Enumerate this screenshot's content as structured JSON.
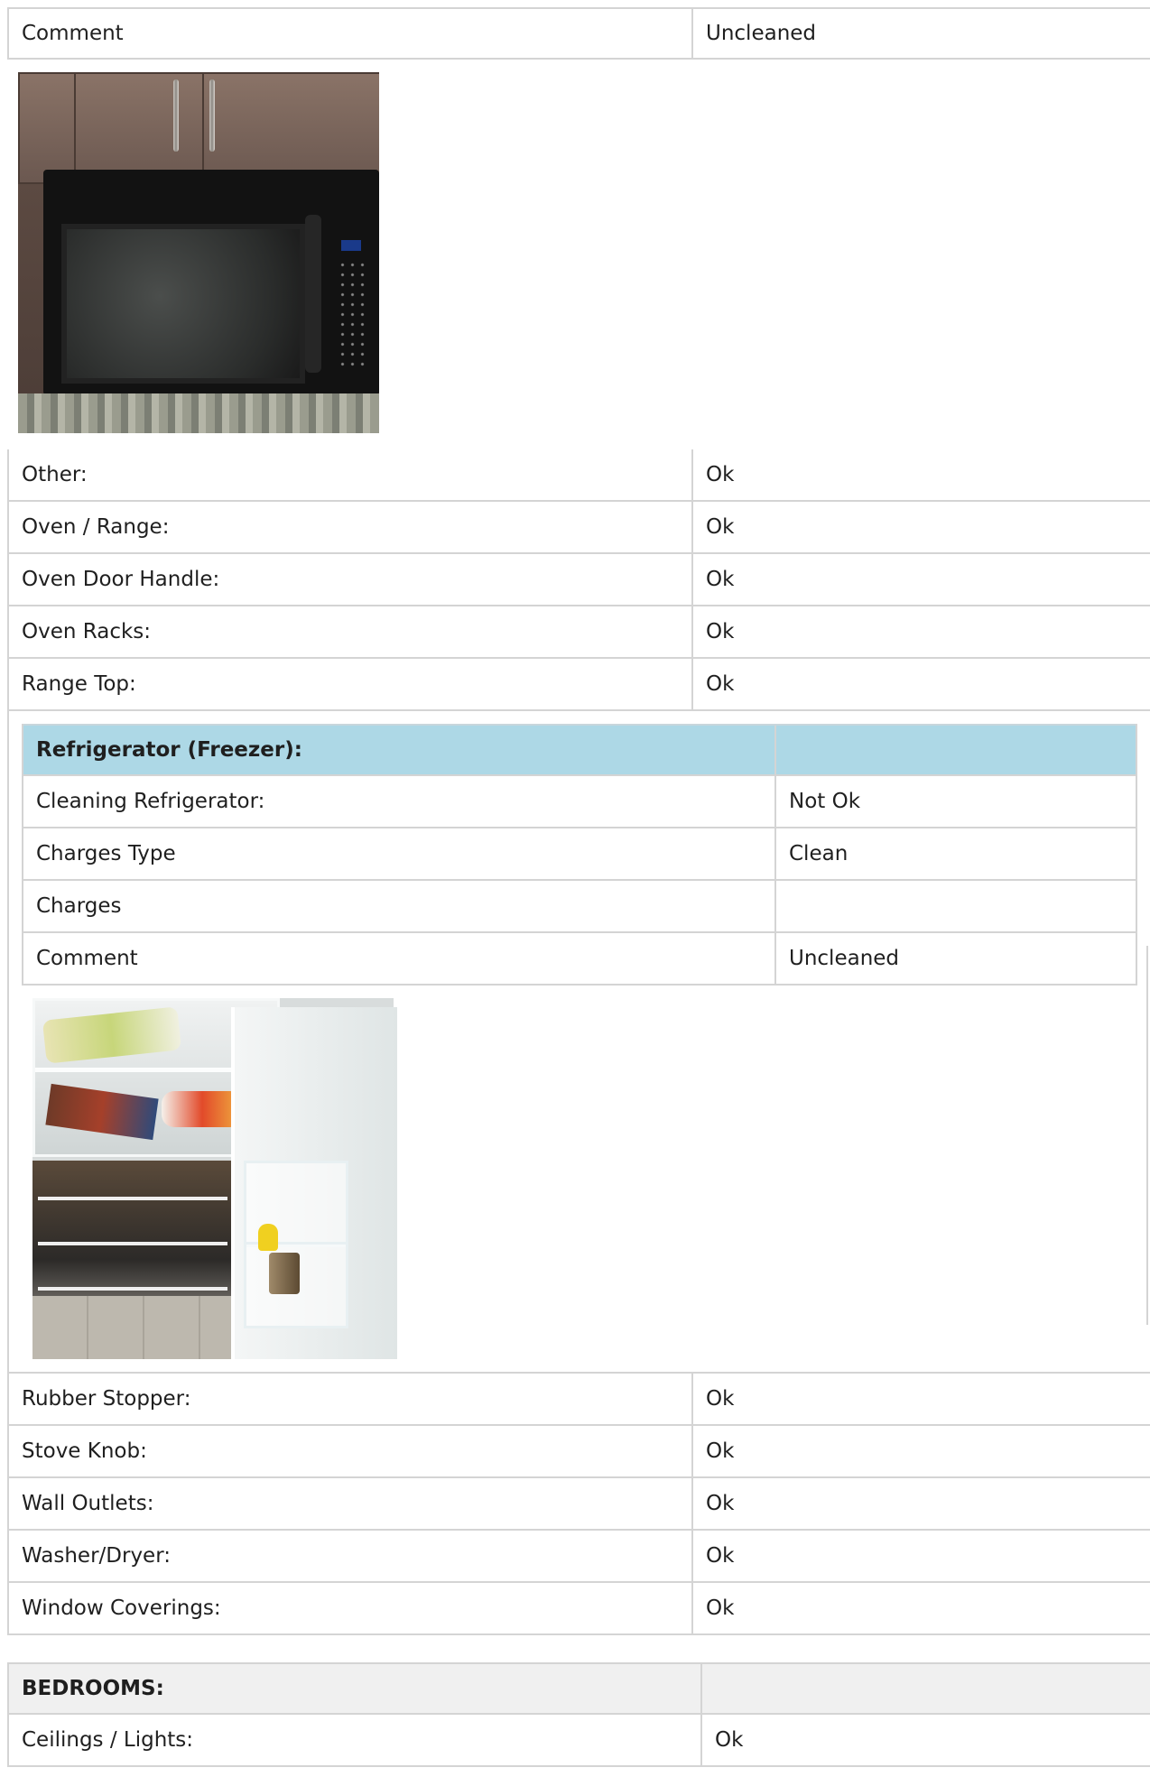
{
  "top_rows": [
    {
      "label": "Comment",
      "value": "Uncleaned"
    }
  ],
  "kitchen_rows": [
    {
      "label": "Other:",
      "value": "Ok"
    },
    {
      "label": "Oven / Range:",
      "value": "Ok"
    },
    {
      "label": "Oven Door Handle:",
      "value": "Ok"
    },
    {
      "label": "Oven Racks:",
      "value": "Ok"
    },
    {
      "label": "Range Top:",
      "value": "Ok"
    }
  ],
  "refrigerator": {
    "title": "Refrigerator (Freezer):",
    "rows": [
      {
        "label": "Cleaning Refrigerator:",
        "value": "Not Ok"
      },
      {
        "label": "Charges Type",
        "value": "Clean"
      },
      {
        "label": "Charges",
        "value": ""
      },
      {
        "label": "Comment",
        "value": "Uncleaned"
      }
    ]
  },
  "kitchen_rows_after": [
    {
      "label": "Rubber Stopper:",
      "value": "Ok"
    },
    {
      "label": "Stove Knob:",
      "value": "Ok"
    },
    {
      "label": "Wall Outlets:",
      "value": "Ok"
    },
    {
      "label": "Washer/Dryer:",
      "value": "Ok"
    },
    {
      "label": "Window Coverings:",
      "value": "Ok"
    }
  ],
  "bedrooms": {
    "title": "BEDROOMS:",
    "rows": [
      {
        "label": "Ceilings / Lights:",
        "value": "Ok"
      }
    ]
  },
  "colors": {
    "header_blue": "#add8e6",
    "header_gray": "#f0f0f0",
    "border": "#d4d4d4"
  }
}
